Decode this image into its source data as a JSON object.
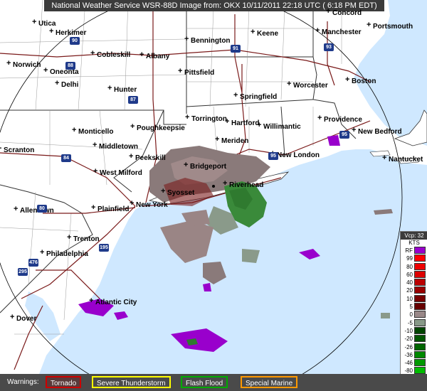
{
  "title": "National Weather Service WSR-88D Image from: OKX 10/11/2011  22:18 UTC  ( 6:18 PM EDT)",
  "cities": [
    {
      "name": "Utica"
    },
    {
      "name": "Herkimer"
    },
    {
      "name": "Cobleskill"
    },
    {
      "name": "Albany"
    },
    {
      "name": "Norwich"
    },
    {
      "name": "Oneonta"
    },
    {
      "name": "Delhi"
    },
    {
      "name": "Hunter"
    },
    {
      "name": "Bennington"
    },
    {
      "name": "Keene"
    },
    {
      "name": "Concord"
    },
    {
      "name": "Manchester"
    },
    {
      "name": "Portsmouth"
    },
    {
      "name": "Pittsfield"
    },
    {
      "name": "Worcester"
    },
    {
      "name": "Boston"
    },
    {
      "name": "Springfield"
    },
    {
      "name": "Torrington"
    },
    {
      "name": "Hartford"
    },
    {
      "name": "Willimantic"
    },
    {
      "name": "Providence"
    },
    {
      "name": "New Bedford"
    },
    {
      "name": "Nantucket"
    },
    {
      "name": "Monticello"
    },
    {
      "name": "Poughkeepsie"
    },
    {
      "name": "Middletown"
    },
    {
      "name": "Meriden"
    },
    {
      "name": "New London"
    },
    {
      "name": "Scranton"
    },
    {
      "name": "Peekskill"
    },
    {
      "name": "Bridgeport"
    },
    {
      "name": "West Milford"
    },
    {
      "name": "Syosset"
    },
    {
      "name": "Riverhead"
    },
    {
      "name": "Allentown"
    },
    {
      "name": "Plainfield"
    },
    {
      "name": "New York"
    },
    {
      "name": "Trenton"
    },
    {
      "name": "Philadelphia"
    },
    {
      "name": "Atlantic City"
    },
    {
      "name": "Dover"
    }
  ],
  "shields": [
    "90",
    "88",
    "87",
    "91",
    "93",
    "95",
    "84",
    "287",
    "278",
    "495",
    "80",
    "78",
    "195",
    "476",
    "295"
  ],
  "legend": {
    "header": "Vcp: 32",
    "unit": "KTS",
    "entries": [
      {
        "label": "RF",
        "color": "#9900cc"
      },
      {
        "label": "99",
        "color": "#ff0000"
      },
      {
        "label": "80",
        "color": "#ee0000"
      },
      {
        "label": "60",
        "color": "#dd0000"
      },
      {
        "label": "40",
        "color": "#bb0000"
      },
      {
        "label": "20",
        "color": "#990000"
      },
      {
        "label": "10",
        "color": "#770000"
      },
      {
        "label": "5",
        "color": "#660000"
      },
      {
        "label": "0",
        "color": "#998888"
      },
      {
        "label": "-5",
        "color": "#889988"
      },
      {
        "label": "-10",
        "color": "#004400"
      },
      {
        "label": "-20",
        "color": "#005500"
      },
      {
        "label": "-26",
        "color": "#006600"
      },
      {
        "label": "-36",
        "color": "#008800"
      },
      {
        "label": "-46",
        "color": "#009900"
      },
      {
        "label": "-80",
        "color": "#00bb00"
      },
      {
        "label": "-99",
        "color": "#00ee00"
      },
      {
        "label": "ND",
        "color": "#bbbbbb"
      }
    ]
  },
  "warnings": {
    "title": "Warnings:",
    "items": [
      {
        "label": "Tornado",
        "border": "#cc0000"
      },
      {
        "label": "Severe Thunderstorm",
        "border": "#ffff00"
      },
      {
        "label": "Flash Flood",
        "border": "#00aa00"
      },
      {
        "label": "Special Marine",
        "border": "#ff9900"
      }
    ]
  },
  "colors": {
    "ocean": "#cfe8ff",
    "land": "#ffffff",
    "roads": "#7a1a1a",
    "range_ring": "#000000",
    "county": "#999999",
    "state": "#333333",
    "velocity_out": "#8a7a7a",
    "velocity_in": "#3a8a3a",
    "rf": "#9900cc"
  }
}
